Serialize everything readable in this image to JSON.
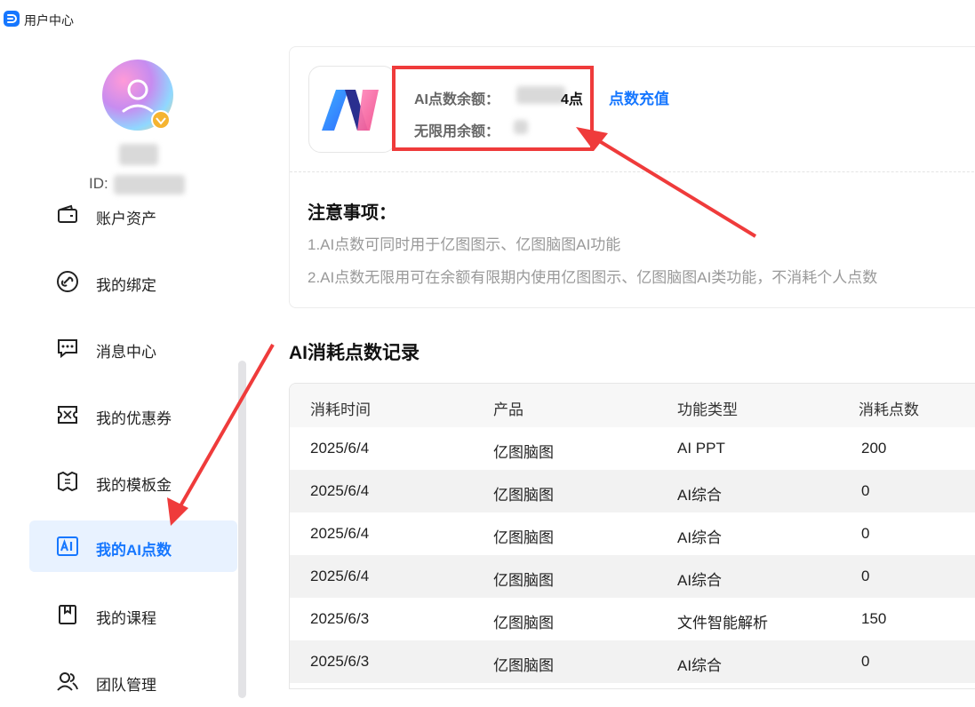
{
  "window": {
    "title": "用户中心"
  },
  "user": {
    "id_prefix": "ID:"
  },
  "sidebar": {
    "items": [
      {
        "label": "账户资产",
        "icon": "wallet-icon"
      },
      {
        "label": "我的绑定",
        "icon": "link-icon"
      },
      {
        "label": "消息中心",
        "icon": "message-icon"
      },
      {
        "label": "我的优惠券",
        "icon": "coupon-icon"
      },
      {
        "label": "我的模板金",
        "icon": "template-coin-icon"
      },
      {
        "label": "我的AI点数",
        "icon": "ai-icon",
        "active": true
      },
      {
        "label": "我的课程",
        "icon": "course-icon"
      },
      {
        "label": "团队管理",
        "icon": "team-icon"
      }
    ]
  },
  "balance": {
    "ai_points_label": "AI点数余额：",
    "ai_points_value": "4点",
    "recharge_link": "点数充值",
    "unlimited_label": "无限用余额："
  },
  "notes": {
    "title": "注意事项：",
    "items": [
      "1.AI点数可同时用于亿图图示、亿图脑图AI功能",
      "2.AI点数无限用可在余额有限期内使用亿图图示、亿图脑图AI类功能，不消耗个人点数"
    ]
  },
  "records": {
    "title": "AI消耗点数记录",
    "columns": [
      "消耗时间",
      "产品",
      "功能类型",
      "消耗点数"
    ],
    "rows": [
      [
        "2025/6/4",
        "亿图脑图",
        "AI PPT",
        "200"
      ],
      [
        "2025/6/4",
        "亿图脑图",
        "AI综合",
        "0"
      ],
      [
        "2025/6/4",
        "亿图脑图",
        "AI综合",
        "0"
      ],
      [
        "2025/6/4",
        "亿图脑图",
        "AI综合",
        "0"
      ],
      [
        "2025/6/3",
        "亿图脑图",
        "文件智能解析",
        "150"
      ],
      [
        "2025/6/3",
        "亿图脑图",
        "AI综合",
        "0"
      ]
    ]
  },
  "colors": {
    "accent": "#1677ff",
    "annotation": "#ef3b3b",
    "active_bg": "#e8f2ff"
  }
}
